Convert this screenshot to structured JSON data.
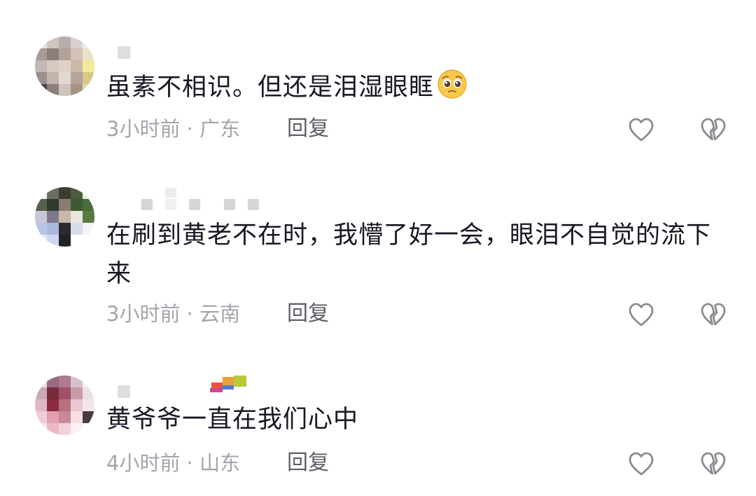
{
  "comments": [
    {
      "text": "虽素不相识。但还是泪湿眼眶",
      "emoji": "pleading-face-emoji",
      "time": "3小时前",
      "location": "广东",
      "reply_label": "回复"
    },
    {
      "text": "在刷到黄老不在时，我懵了好一会，眼泪不自觉的流下来",
      "time": "3小时前",
      "location": "云南",
      "reply_label": "回复"
    },
    {
      "text": "黄爷爷一直在我们心中",
      "time": "4小时前",
      "location": "山东",
      "reply_label": "回复"
    }
  ],
  "separator": "·",
  "icons": {
    "like": "heart-outline-icon",
    "dislike": "broken-heart-outline-icon"
  },
  "colors": {
    "text": "#161823",
    "meta": "#a3a5ab",
    "reply": "#5c5e66",
    "icon": "#8a8b91"
  }
}
